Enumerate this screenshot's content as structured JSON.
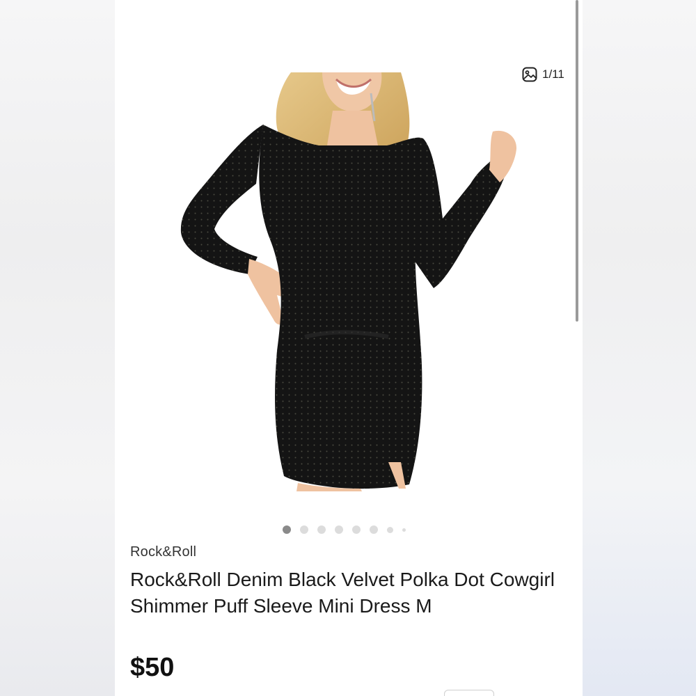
{
  "gallery": {
    "counter": "1/11",
    "current_index": 1,
    "total": 11,
    "image_alt": "Woman wearing black velvet polka dot long sleeve mini dress"
  },
  "listing": {
    "brand": "Rock&Roll",
    "title": "Rock&Roll Denim Black Velvet Polka Dot Cowgirl Shimmer Puff Sleeve Mini Dress M",
    "price": "$50"
  },
  "icons": {
    "gallery_icon": "image-gallery-icon"
  },
  "colors": {
    "background": "#ffffff",
    "text": "#1a1a1a",
    "dot_active": "#8a8a8a",
    "dot_inactive": "#dcdcdc"
  }
}
